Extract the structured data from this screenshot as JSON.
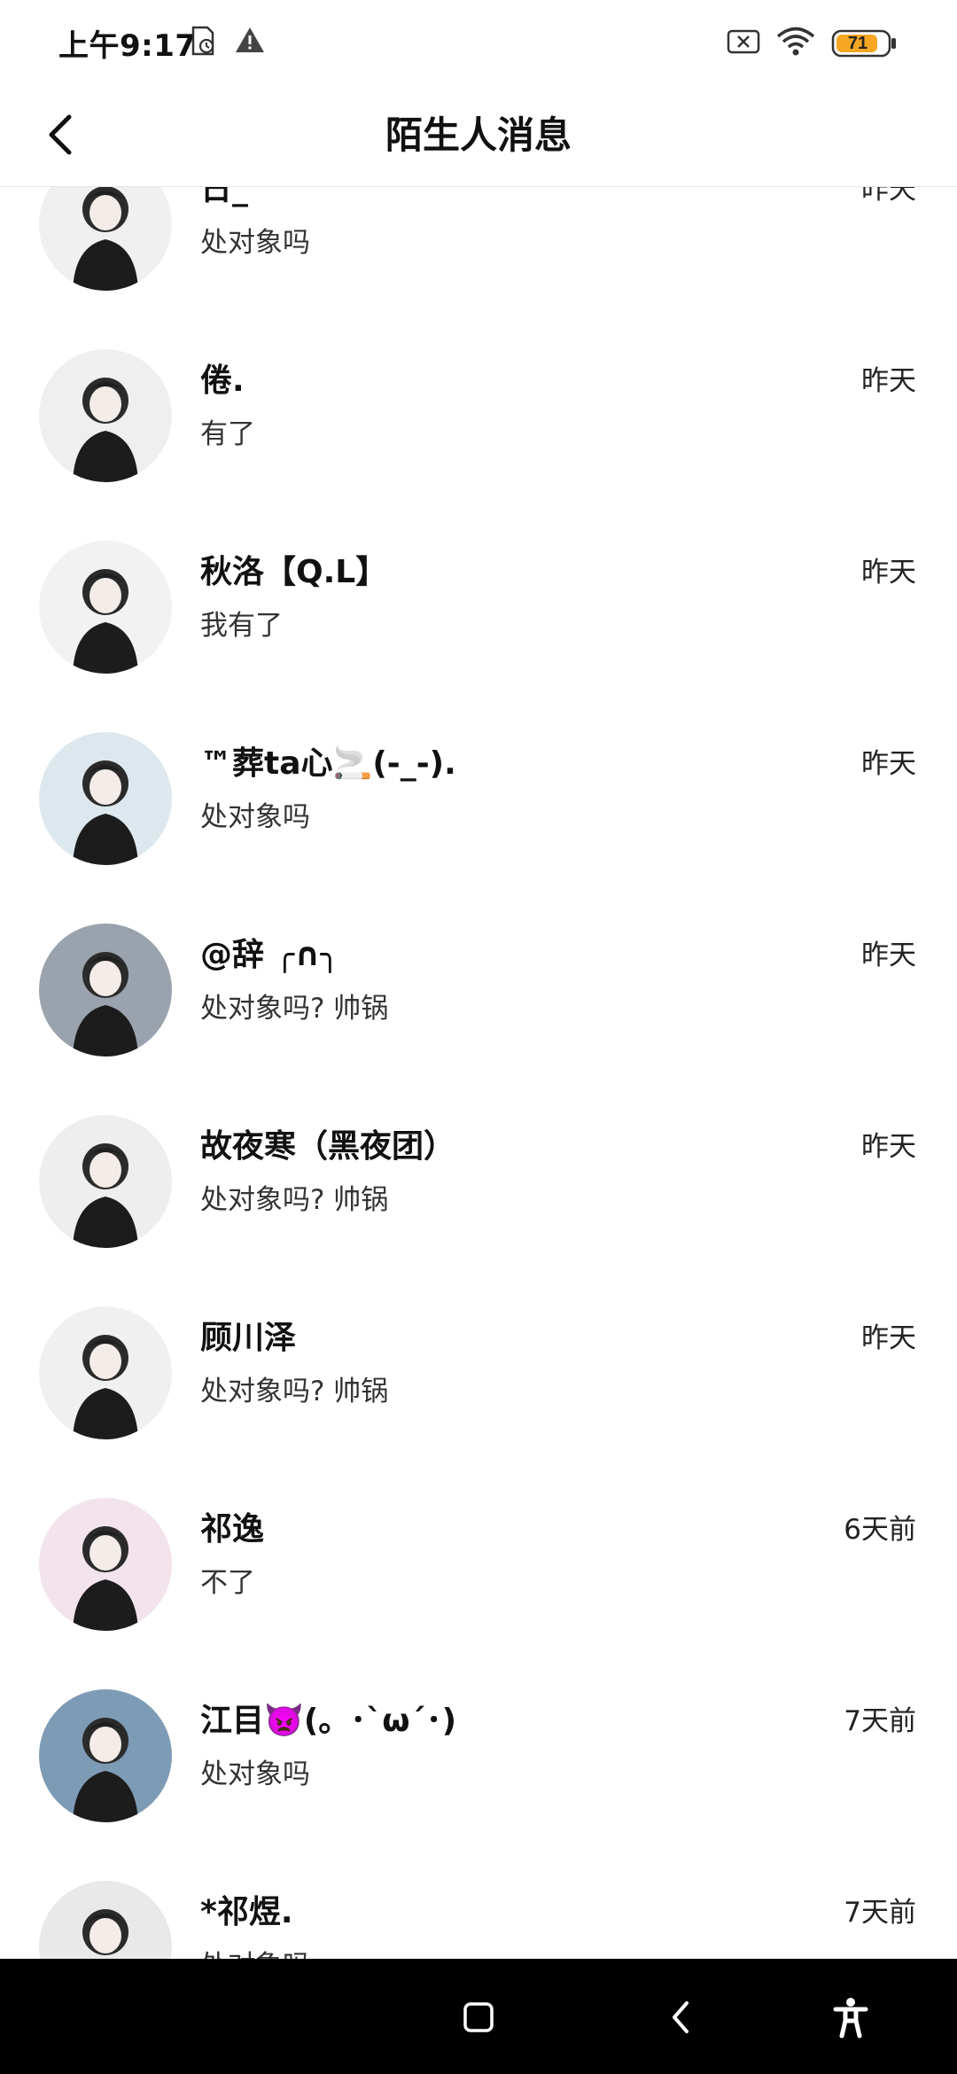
{
  "status_bar": {
    "time": "上午9:17",
    "battery_level": "71",
    "icons_left": [
      "storage-clock-icon",
      "warning-icon"
    ],
    "icons_right": [
      "sim-off-icon",
      "wifi-icon",
      "battery-icon"
    ]
  },
  "header": {
    "title": "陌生人消息",
    "back_icon": "chevron-left-icon"
  },
  "conversations": [
    {
      "name": "日_",
      "time": "昨天",
      "preview": "处对象吗",
      "avatar_bg": "#f0f0f0"
    },
    {
      "name": "倦.",
      "time": "昨天",
      "preview": "有了",
      "avatar_bg": "#efefef"
    },
    {
      "name": "秋洛【Q.L】",
      "time": "昨天",
      "preview": "我有了",
      "avatar_bg": "#f2f2f2"
    },
    {
      "name": "™葬ta心🚬(-_-).",
      "time": "昨天",
      "preview": "处对象吗",
      "avatar_bg": "#dde8ee"
    },
    {
      "name": "@辞 ╭∩╮",
      "time": "昨天",
      "preview": "处对象吗? 帅锅",
      "avatar_bg": "#9aa3ad"
    },
    {
      "name": "故夜寒（黑夜团）",
      "time": "昨天",
      "preview": "处对象吗? 帅锅",
      "avatar_bg": "#eeeeee"
    },
    {
      "name": "顾川泽",
      "time": "昨天",
      "preview": "处对象吗? 帅锅",
      "avatar_bg": "#f0f0f0"
    },
    {
      "name": "祁逸",
      "time": "6天前",
      "preview": "不了",
      "avatar_bg": "#f3e3ec"
    },
    {
      "name": "江目👿(。･`ω´･)",
      "time": "7天前",
      "preview": "处对象吗",
      "avatar_bg": "#7e9bb6"
    },
    {
      "name": "*祁煜.",
      "time": "7天前",
      "preview": "处对象吗",
      "avatar_bg": "#e9e9e9"
    }
  ],
  "nav_bar": {
    "buttons": [
      "recents-square-icon",
      "back-triangle-icon",
      "accessibility-icon"
    ]
  },
  "colors": {
    "background": "#ffffff",
    "nav_bar": "#000000",
    "text_primary": "#111111",
    "battery": "#f5a623"
  }
}
